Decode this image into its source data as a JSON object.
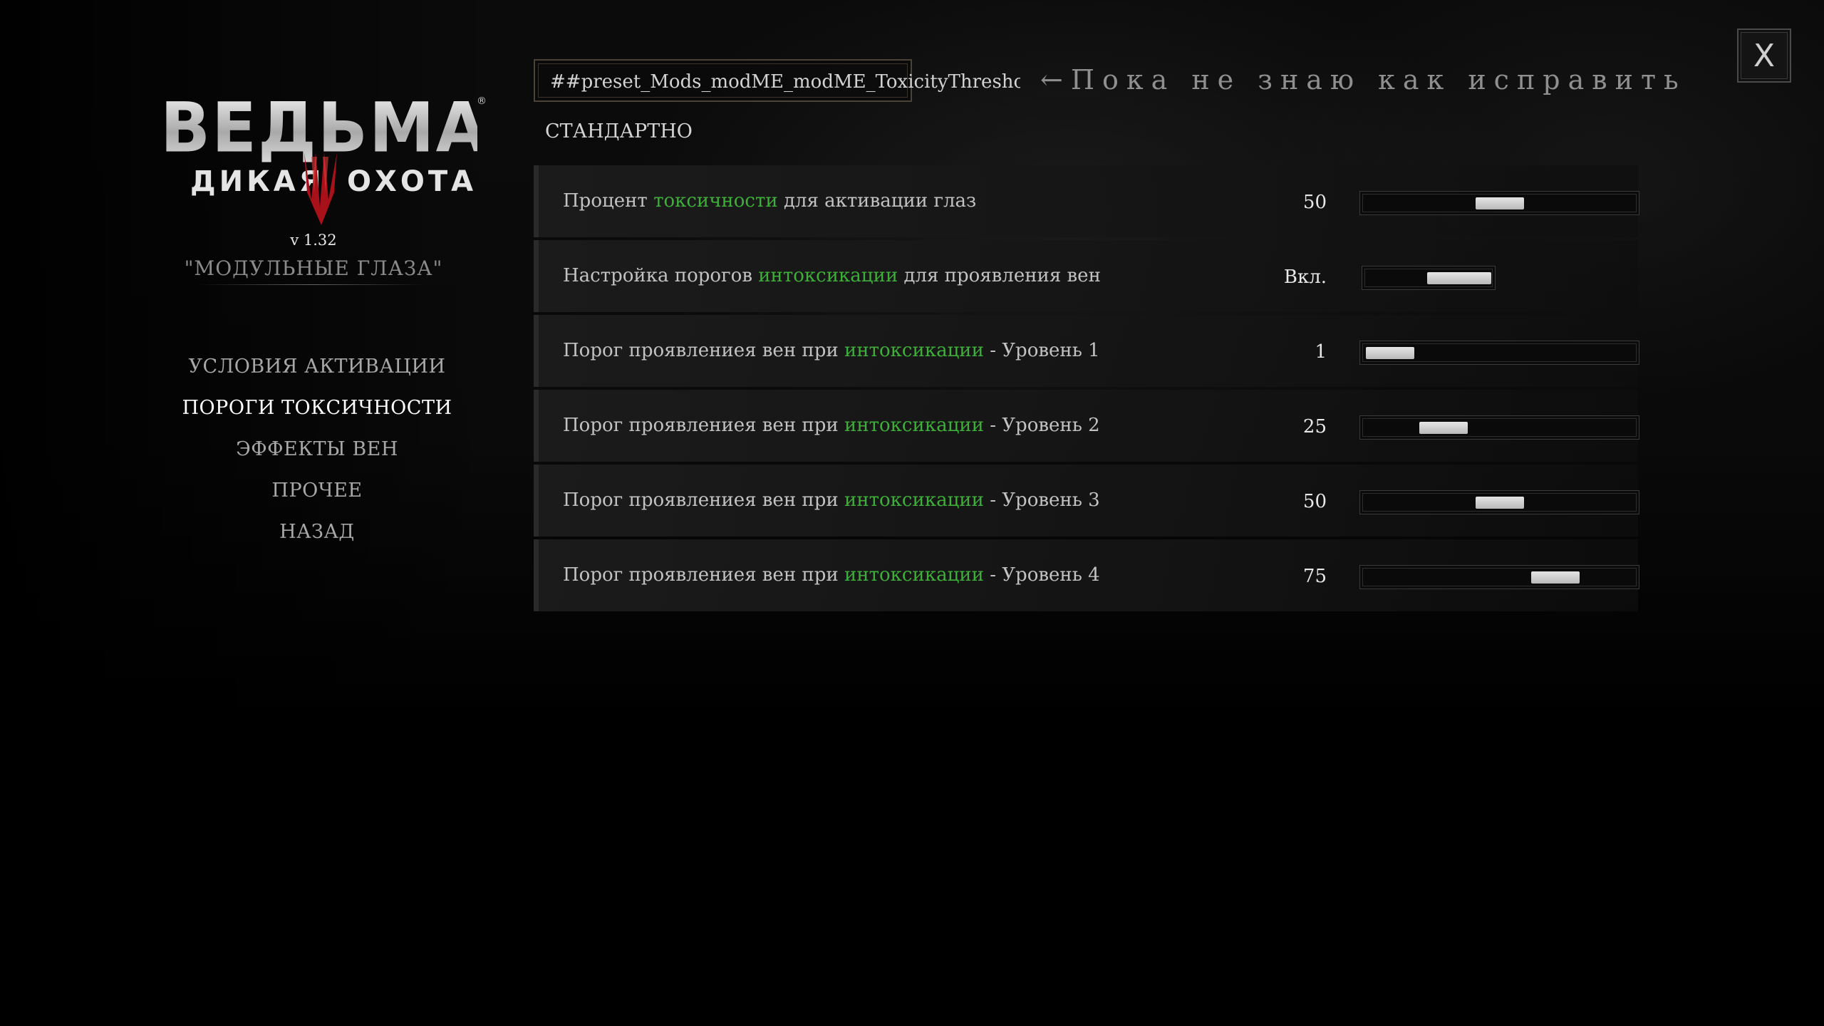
{
  "logo": {
    "title": "ВЕДЬМАК",
    "registered": "®",
    "subtitle_left": "ДИКАЯ",
    "subtitle_right": "ОХОТА"
  },
  "version": "v 1.32",
  "mod_name": "\"МОДУЛЬНЫЕ ГЛАЗА\"",
  "nav": {
    "items": [
      {
        "label": "УСЛОВИЯ АКТИВАЦИИ",
        "active": false
      },
      {
        "label": "ПОРОГИ ТОКСИЧНОСТИ",
        "active": true
      },
      {
        "label": "ЭФФЕКТЫ ВЕН",
        "active": false
      },
      {
        "label": "ПРОЧЕЕ",
        "active": false
      },
      {
        "label": "НАЗАД",
        "active": false
      }
    ]
  },
  "header": {
    "preset_id": "##preset_Mods_modME_modME_ToxicityThresho",
    "annotation": "←Пока не знаю как исправить",
    "preset_label": "СТАНДАРТНО",
    "close_label": "X"
  },
  "colors": {
    "highlight": "#3fae3a",
    "text": "#c2c2c2",
    "active_nav": "#ffffff"
  },
  "settings": [
    {
      "label_before": "Процент ",
      "label_highlight": "токсичности",
      "label_after": " для активации глаз",
      "value": "50",
      "type": "slider",
      "fraction": 0.5
    },
    {
      "label_before": "Настройка порогов ",
      "label_highlight": "интоксикации",
      "label_after": " для проявления вен",
      "value": "Вкл.",
      "type": "toggle",
      "fraction": 1
    },
    {
      "label_before": "Порог проявлениея вен при ",
      "label_highlight": "интоксикации",
      "label_after": " - Уровень 1",
      "value": "1",
      "type": "slider",
      "fraction": 0.01
    },
    {
      "label_before": "Порог проявлениея вен при ",
      "label_highlight": "интоксикации",
      "label_after": " - Уровень 2",
      "value": "25",
      "type": "slider",
      "fraction": 0.25
    },
    {
      "label_before": "Порог проявлениея вен при ",
      "label_highlight": "интоксикации",
      "label_after": " - Уровень 3",
      "value": "50",
      "type": "slider",
      "fraction": 0.5
    },
    {
      "label_before": "Порог проявлениея вен при ",
      "label_highlight": "интоксикации",
      "label_after": " - Уровень 4",
      "value": "75",
      "type": "slider",
      "fraction": 0.75
    }
  ]
}
